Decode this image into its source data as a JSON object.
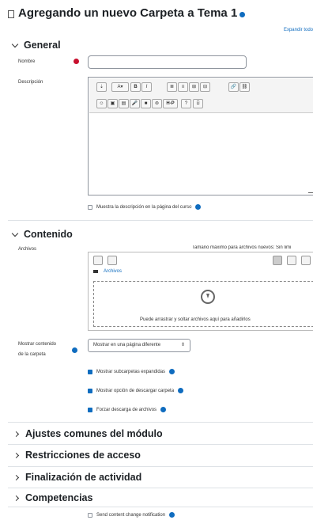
{
  "page": {
    "title": "Agregando un nuevo Carpeta a Tema 1",
    "expand_all": "Expandir todo"
  },
  "general": {
    "heading": "General",
    "name_label": "Nombre",
    "name_value": "",
    "description_label": "Descripción",
    "show_description_label": "Muestra la descripción en la página del curso"
  },
  "editor": {
    "toolbar_row1": [
      "⇣",
      "A▾",
      "B",
      "I",
      "≣",
      "≡",
      "⊞",
      "⊟",
      "🔗",
      "⛓"
    ],
    "toolbar_row2": [
      "☺",
      "▣",
      "▤",
      "🎤",
      "■",
      "⊚",
      "H-P",
      "?",
      "⌸"
    ]
  },
  "content": {
    "heading": "Contenido",
    "files_label": "Archivos",
    "max_size_text": "Tamaño máximo para archivos nuevos: Sin limi",
    "breadcrumb": "Archivos",
    "drop_text": "Puede arrastrar y soltar archivos aquí para añadirlos",
    "display_label_line1": "Mostrar contenido",
    "display_label_line2": "de la carpeta",
    "display_value": "Mostrar en una página diferente",
    "options": [
      {
        "label": "Mostrar subcarpetas expandidas",
        "checked": true
      },
      {
        "label": "Mostrar opción de descargar carpeta",
        "checked": true
      },
      {
        "label": "Forzar descarga de archivos",
        "checked": true
      }
    ]
  },
  "collapsed_sections": [
    "Ajustes comunes del módulo",
    "Restricciones de acceso",
    "Finalización de actividad",
    "Competencias"
  ],
  "footer": {
    "notification_label": "Send content change notification",
    "notification_checked": false
  },
  "colors": {
    "accent": "#0f6cbf",
    "required": "#c8102e"
  }
}
